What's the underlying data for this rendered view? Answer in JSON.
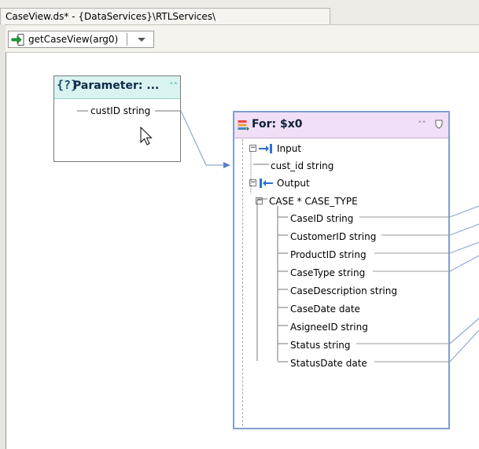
{
  "window": {
    "tab_title": "CaseView.ds* - {DataServices}\\RTLServices\\"
  },
  "toolbar": {
    "operation_label": "getCaseView(arg0)",
    "operation_icon": "green-arrow-icon",
    "dropdown_icon": "chevron-down-icon"
  },
  "parameter_node": {
    "title": "Parameter: ...",
    "icon": "braces-question-icon",
    "fields": [
      {
        "label": "custID  string"
      }
    ]
  },
  "for_node": {
    "title": "For: $x0",
    "input_label": "Input",
    "input_field": "cust_id string",
    "output_label": "Output",
    "output_group": "CASE * CASE_TYPE",
    "fields": [
      "CaseID  string",
      "CustomerID  string",
      "ProductID  string",
      "CaseType  string",
      "CaseDescription  string",
      "CaseDate  date",
      "AsigneeID  string",
      "Status  string",
      "StatusDate  date"
    ]
  },
  "colors": {
    "param_header": "#d9f4f0",
    "for_header": "#f1dff7",
    "for_border": "#7f9fcf",
    "wire": "#8fa7d2"
  }
}
